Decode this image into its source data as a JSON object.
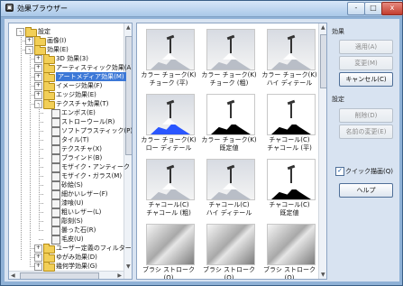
{
  "window": {
    "title": "効果ブラウザー",
    "app_icon": "app-icon",
    "controls": [
      "-",
      "□",
      "x"
    ]
  },
  "tree": {
    "items": [
      {
        "label": "設定",
        "level": 0,
        "expander": "-"
      },
      {
        "label": "画像(I)",
        "level": 1,
        "expander": "+"
      },
      {
        "label": "効果(E)",
        "level": 1,
        "expander": "-"
      },
      {
        "label": "3D 効果(3)",
        "level": 2,
        "expander": "+"
      },
      {
        "label": "アーティスティック効果(A)",
        "level": 2,
        "expander": "+"
      },
      {
        "label": "アートメディア効果(M)",
        "level": 2,
        "expander": "+",
        "selected": true
      },
      {
        "label": "イメージ効果(F)",
        "level": 2,
        "expander": "+"
      },
      {
        "label": "エッジ効果(E)",
        "level": 2,
        "expander": "+"
      },
      {
        "label": "テクスチャ効果(T)",
        "level": 2,
        "expander": "-"
      },
      {
        "label": "エンボス(E)",
        "level": 3
      },
      {
        "label": "ストローウール(R)",
        "level": 3
      },
      {
        "label": "ソフトプラスティック(P)",
        "level": 3
      },
      {
        "label": "タイル(T)",
        "level": 3
      },
      {
        "label": "テクスチャ(X)",
        "level": 3
      },
      {
        "label": "ブラインド(B)",
        "level": 3
      },
      {
        "label": "モザイク・アンティーク",
        "level": 3
      },
      {
        "label": "モザイク・ガラス(M)",
        "level": 3
      },
      {
        "label": "砂絵(S)",
        "level": 3
      },
      {
        "label": "細かいレザー(F)",
        "level": 3
      },
      {
        "label": "漆喰(U)",
        "level": 3
      },
      {
        "label": "粗いレザー(L)",
        "level": 3
      },
      {
        "label": "彫刻(S)",
        "level": 3
      },
      {
        "label": "曇った石(R)",
        "level": 3
      },
      {
        "label": "毛皮(U)",
        "level": 3
      },
      {
        "label": "ユーザー定義のフィルター",
        "level": 2,
        "expander": "+"
      },
      {
        "label": "ゆがみ効果(D)",
        "level": 2,
        "expander": "+"
      },
      {
        "label": "幾何学効果(G)",
        "level": 2,
        "expander": "+"
      }
    ]
  },
  "preview": {
    "cells": [
      {
        "caption": [
          "カラー チョーク(K)",
          "チョーク (平)"
        ],
        "style": "normal"
      },
      {
        "caption": [
          "カラー チョーク(K)",
          "チョーク (粗)"
        ],
        "style": "normal"
      },
      {
        "caption": [
          "カラー チョーク(K)",
          "ハイ ディテール"
        ],
        "style": "normal"
      },
      {
        "caption": [
          "カラー チョーク(K)",
          "ロー ディテール"
        ],
        "style": "blue"
      },
      {
        "caption": [
          "カラー チョーク(K)",
          "既定値"
        ],
        "style": "bw"
      },
      {
        "caption": [
          "チャコール(C)",
          "チャコール (平)"
        ],
        "style": "bw"
      },
      {
        "caption": [
          "チャコール(C)",
          "チャコール (粗)"
        ],
        "style": "normal"
      },
      {
        "caption": [
          "チャコール(C)",
          "ハイ ディテール"
        ],
        "style": "normal"
      },
      {
        "caption": [
          "チャコール(C)",
          "既定値"
        ],
        "style": "bw"
      },
      {
        "caption": [
          "ブラシ ストローク(O)"
        ],
        "style": "emboss"
      },
      {
        "caption": [
          "ブラシ ストローク(O)"
        ],
        "style": "emboss"
      },
      {
        "caption": [
          "ブラシ ストローク(O)"
        ],
        "style": "emboss"
      }
    ]
  },
  "side": {
    "effects_label": "効果",
    "apply": "適用(A)",
    "modify": "変更(M)",
    "cancel": "キャンセル(C)",
    "settings_label": "設定",
    "delete": "削除(D)",
    "rename": "名前の変更(E)",
    "quick_preview": "クイック描画(Q)",
    "help": "ヘルプ"
  }
}
